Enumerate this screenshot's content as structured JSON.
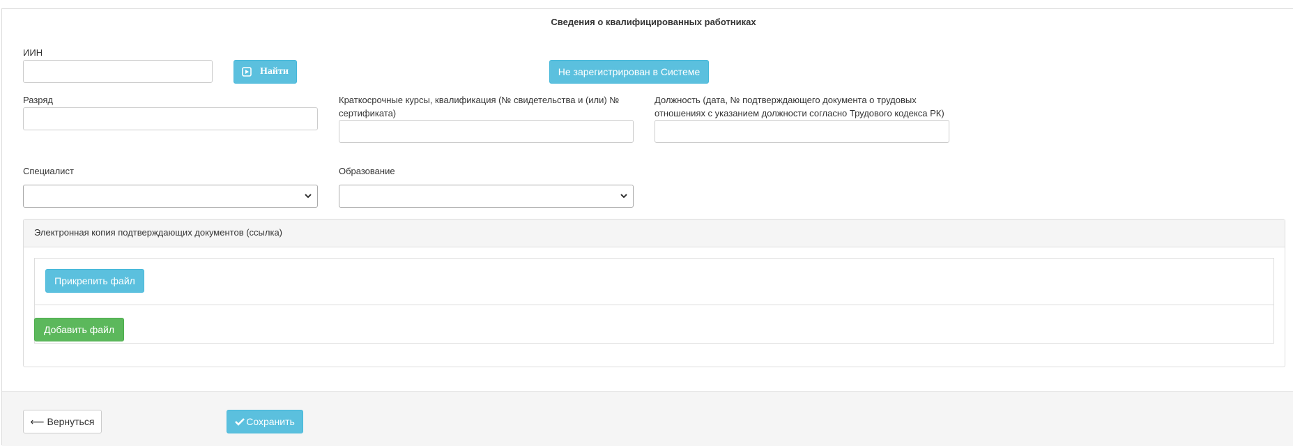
{
  "form": {
    "title": "Сведения о квалифицированных работниках",
    "iin": {
      "label": "ИИН",
      "value": ""
    },
    "find_button": "Найти",
    "not_registered_button": "Не зарегистрирован в Системе",
    "grade": {
      "label": "Разряд",
      "value": ""
    },
    "courses": {
      "label_line1": "Краткосрочные курсы, квалификация (№ свидетельства и (или) №",
      "label_line2": "сертификата)",
      "value": ""
    },
    "position": {
      "label_line1": "Должность (дата, № подтверждающего документа о трудовых",
      "label_line2": "отношениях с указанием должности согласно Трудового кодекса РК)",
      "value": ""
    },
    "specialist": {
      "label": "Специалист",
      "selected": ""
    },
    "education": {
      "label": "Образование",
      "selected": ""
    }
  },
  "attachments": {
    "panel_title": "Электронная копия подтверждающих документов (ссылка)",
    "attach_button": "Прикрепить файл",
    "add_button": "Добавить файл"
  },
  "footer": {
    "back_button": "⟵ Вернуться",
    "save_button": "Сохранить"
  },
  "colors": {
    "info": "#5bc0de",
    "success": "#5cb85c",
    "panel_bg": "#f5f5f5"
  },
  "icons": [
    "play-square-icon",
    "chevron-down-icon",
    "checkmark-icon",
    "arrow-left-icon"
  ]
}
